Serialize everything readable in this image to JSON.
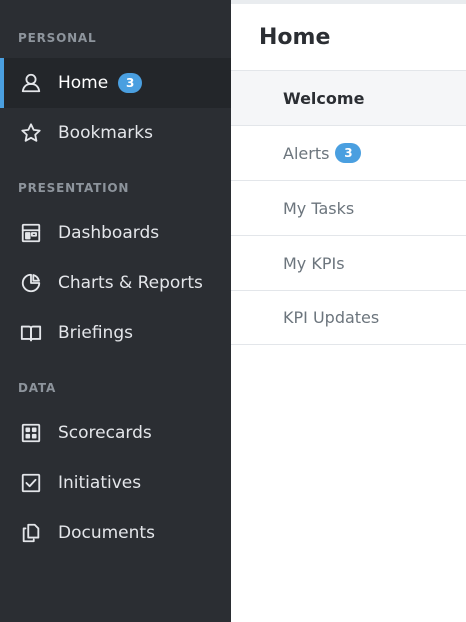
{
  "sidebar": {
    "sections": [
      {
        "label": "PERSONAL",
        "items": [
          {
            "label": "Home",
            "icon": "user-icon",
            "badge": "3",
            "active": true
          },
          {
            "label": "Bookmarks",
            "icon": "star-icon"
          }
        ]
      },
      {
        "label": "PRESENTATION",
        "items": [
          {
            "label": "Dashboards",
            "icon": "dashboard-icon"
          },
          {
            "label": "Charts & Reports",
            "icon": "pie-chart-icon"
          },
          {
            "label": "Briefings",
            "icon": "book-icon"
          }
        ]
      },
      {
        "label": "DATA",
        "items": [
          {
            "label": "Scorecards",
            "icon": "scorecard-icon"
          },
          {
            "label": "Initiatives",
            "icon": "checkbox-icon"
          },
          {
            "label": "Documents",
            "icon": "documents-icon"
          }
        ]
      }
    ]
  },
  "main": {
    "title": "Home",
    "subnav": [
      {
        "label": "Welcome",
        "active": true
      },
      {
        "label": "Alerts",
        "badge": "3"
      },
      {
        "label": "My Tasks"
      },
      {
        "label": "My KPIs"
      },
      {
        "label": "KPI Updates"
      }
    ]
  },
  "colors": {
    "sidebar_bg": "#2b2e33",
    "accent": "#4a9fe0",
    "active_bg": "#23262a"
  }
}
